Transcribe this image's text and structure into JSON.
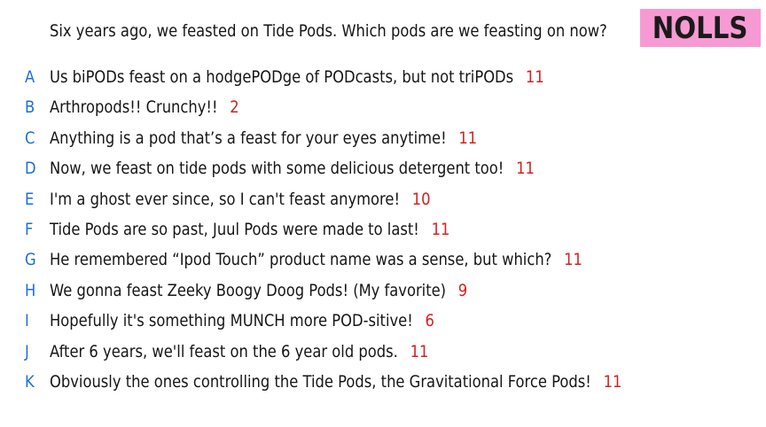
{
  "logo": {
    "text": "NOLLS"
  },
  "question": "Six years ago, we feasted on Tide Pods. Which pods are we feasting on now?",
  "answers": [
    {
      "letter": "A",
      "text": "Us biPODs feast on a hodgePODge of PODcasts, but not triPODs",
      "votes": "11"
    },
    {
      "letter": "B",
      "text": "Arthropods!! Crunchy!!",
      "votes": "2"
    },
    {
      "letter": "C",
      "text": "Anything is a pod that’s a feast for your eyes anytime!",
      "votes": "11"
    },
    {
      "letter": "D",
      "text": "Now, we feast on tide pods with some delicious detergent too!",
      "votes": "11"
    },
    {
      "letter": "E",
      "text": "I'm a ghost ever since, so I can't feast anymore!",
      "votes": "10"
    },
    {
      "letter": "F",
      "text": "Tide Pods are so past, Juul Pods were made to last!",
      "votes": "11"
    },
    {
      "letter": "G",
      "text": "He remembered “Ipod Touch” product name was a sense, but which?",
      "votes": "11"
    },
    {
      "letter": "H",
      "text": "We gonna feast Zeeky Boogy Doog Pods! (My favorite)",
      "votes": "9"
    },
    {
      "letter": "I",
      "text": "Hopefully it's something MUNCH more POD-sitive!",
      "votes": "6"
    },
    {
      "letter": "J",
      "text": "After 6 years, we'll feast on the 6 year old pods.",
      "votes": "11"
    },
    {
      "letter": "K",
      "text": "Obviously the ones controlling the Tide Pods, the Gravitational Force Pods!",
      "votes": "11"
    }
  ],
  "colors": {
    "letter": "#1d6fd4",
    "votes": "#d42020",
    "logo_bg": "#f79ad4",
    "text": "#151515"
  }
}
